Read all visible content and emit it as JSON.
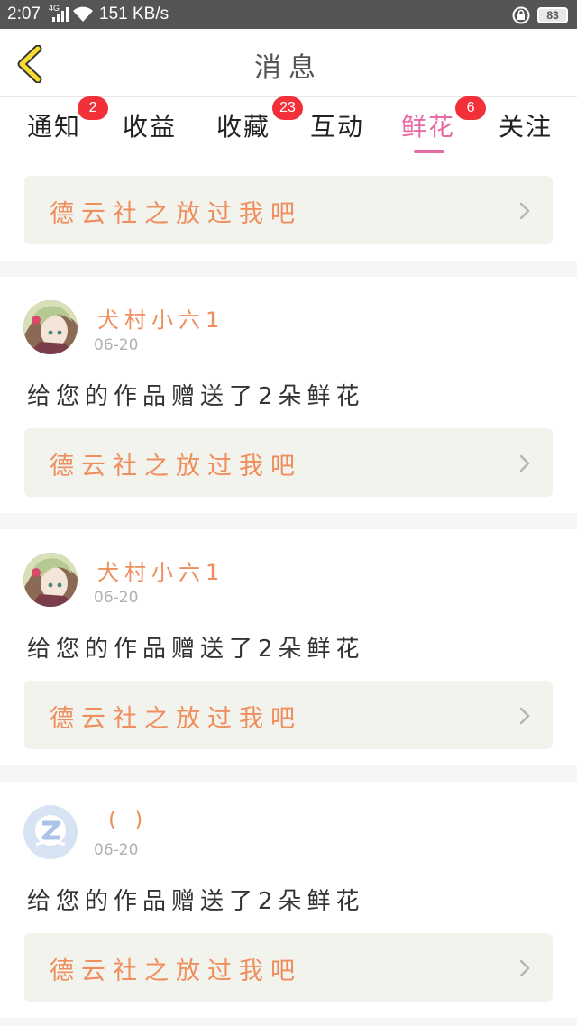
{
  "status_bar": {
    "time": "2:07",
    "network": "4G",
    "speed": "151 KB/s",
    "battery": "83",
    "icons": [
      "signal-icon",
      "wifi-icon",
      "lock-rotation-icon",
      "battery-icon"
    ]
  },
  "header": {
    "title": "消息",
    "back_icon": "back-chevron-icon"
  },
  "tabs": [
    {
      "label": "通知",
      "badge": "2",
      "active": false
    },
    {
      "label": "收益",
      "badge": "",
      "active": false
    },
    {
      "label": "收藏",
      "badge": "23",
      "active": false
    },
    {
      "label": "互动",
      "badge": "",
      "active": false
    },
    {
      "label": "鲜花",
      "badge": "6",
      "active": true
    },
    {
      "label": "关注",
      "badge": "",
      "active": false
    }
  ],
  "colors": {
    "accent": "#e66ba4",
    "badge": "#f2303a",
    "work_title": "#ef8e5d",
    "card_bg": "#f3f3ee"
  },
  "top_card": {
    "work_title": "德云社之放过我吧"
  },
  "messages": [
    {
      "user": "犬村小六1",
      "date": "06-20",
      "text": "给您的作品赠送了2朵鲜花",
      "work_title": "德云社之放过我吧",
      "avatar": "anime-girl-avatar"
    },
    {
      "user": "犬村小六1",
      "date": "06-20",
      "text": "给您的作品赠送了2朵鲜花",
      "work_title": "德云社之放过我吧",
      "avatar": "anime-girl-avatar"
    },
    {
      "user": "( )",
      "date": "06-20",
      "text": "给您的作品赠送了2朵鲜花",
      "work_title": "德云社之放过我吧",
      "avatar": "default-z-avatar"
    }
  ]
}
